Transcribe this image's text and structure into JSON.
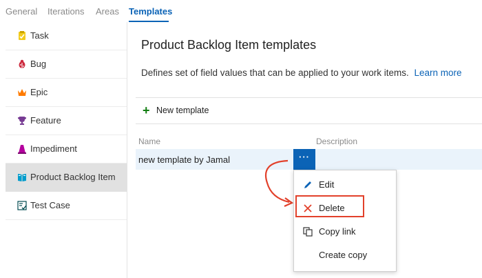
{
  "tabs": [
    {
      "label": "General",
      "active": false
    },
    {
      "label": "Iterations",
      "active": false
    },
    {
      "label": "Areas",
      "active": false
    },
    {
      "label": "Templates",
      "active": true
    }
  ],
  "sidebar": {
    "items": [
      {
        "label": "Task",
        "icon": "task-icon",
        "color": "#f2cb1d"
      },
      {
        "label": "Bug",
        "icon": "bug-icon",
        "color": "#cc293d"
      },
      {
        "label": "Epic",
        "icon": "crown-icon",
        "color": "#ff7b00"
      },
      {
        "label": "Feature",
        "icon": "trophy-icon",
        "color": "#773b93"
      },
      {
        "label": "Impediment",
        "icon": "impediment-icon",
        "color": "#b4009e"
      },
      {
        "label": "Product Backlog Item",
        "icon": "book-icon",
        "color": "#009ccc",
        "selected": true
      },
      {
        "label": "Test Case",
        "icon": "test-case-icon",
        "color": "#004b50"
      }
    ]
  },
  "main": {
    "title": "Product Backlog Item templates",
    "description": "Defines set of field values that can be applied to your work items.",
    "learn_more": "Learn more",
    "new_template": "New template",
    "columns": {
      "name": "Name",
      "description": "Description"
    },
    "rows": [
      {
        "name": "new template by Jamal",
        "description": ""
      }
    ],
    "more_actions": "···"
  },
  "menu": {
    "items": [
      {
        "label": "Edit",
        "icon": "pencil-icon"
      },
      {
        "label": "Delete",
        "icon": "close-icon"
      },
      {
        "label": "Copy link",
        "icon": "copy-link-icon"
      },
      {
        "label": "Create copy",
        "icon": ""
      }
    ]
  },
  "colors": {
    "accent": "#0b63b6",
    "callout": "#e2402a",
    "add": "#107c10"
  }
}
